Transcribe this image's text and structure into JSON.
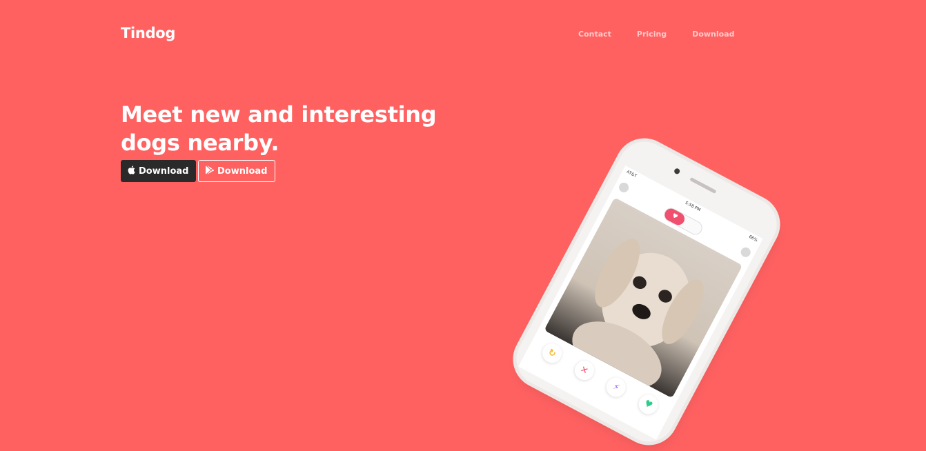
{
  "brand": "Tindog",
  "nav": {
    "items": [
      "Contact",
      "Pricing",
      "Download"
    ]
  },
  "hero": {
    "headline_line1": "Meet new and interesting",
    "headline_line2": "dogs nearby.",
    "apple_button_label": "Download",
    "play_button_label": "Download"
  },
  "phone": {
    "carrier": "AT&T",
    "time": "5:58 PM",
    "battery": "66%"
  },
  "colors": {
    "background": "#ff6161",
    "dark_button": "#2a2a2a",
    "accent": "#f0506e"
  }
}
